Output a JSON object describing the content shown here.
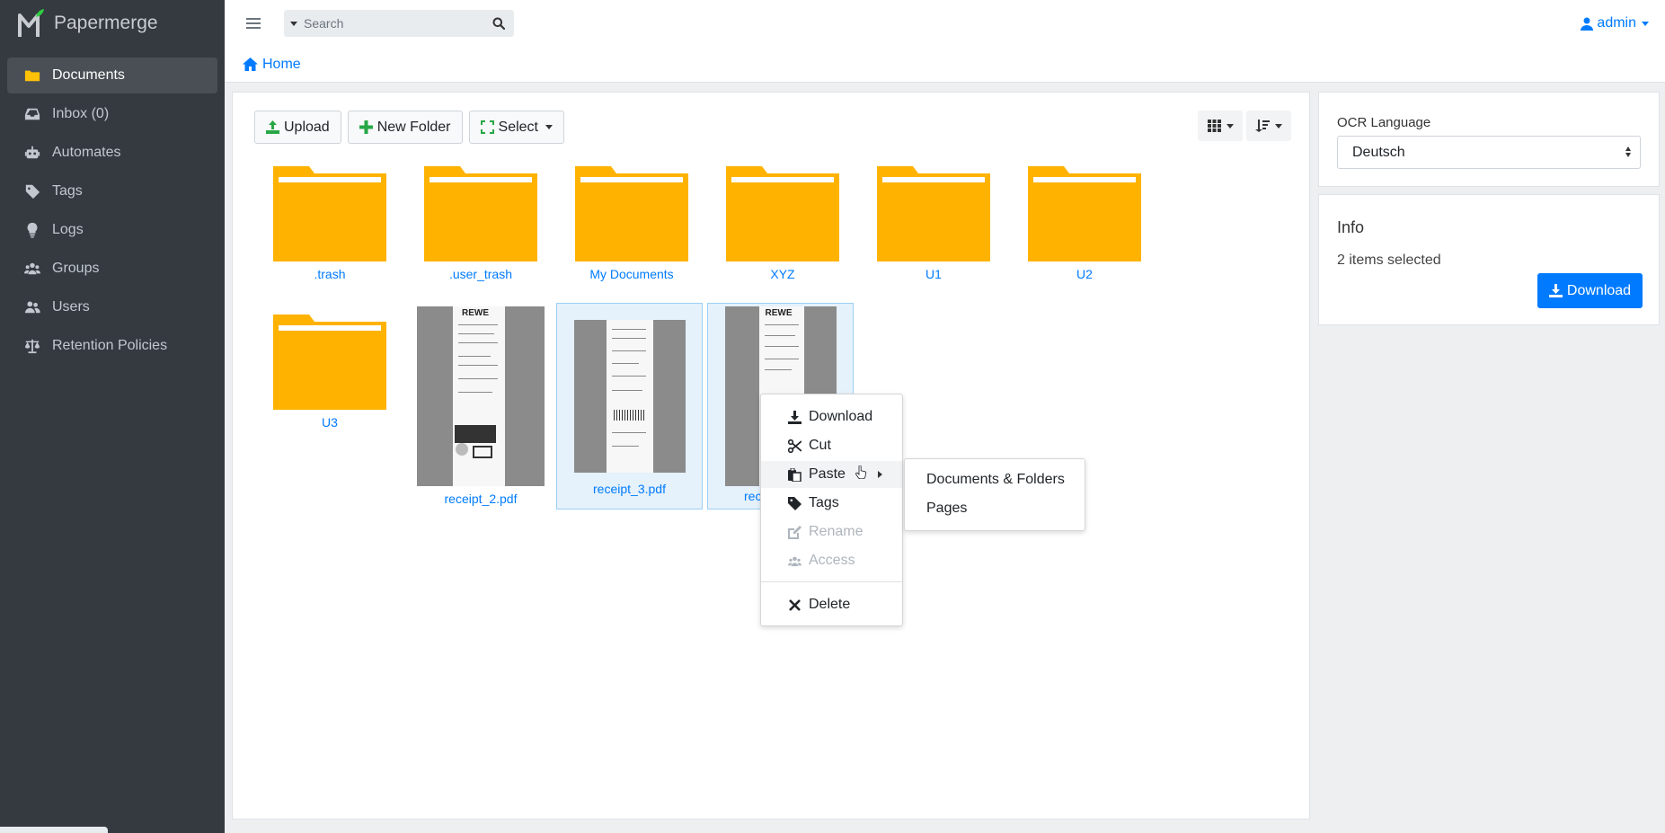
{
  "app": {
    "name": "Papermerge"
  },
  "sidebar": {
    "items": [
      {
        "label": "Documents",
        "icon": "folder-icon",
        "active": true
      },
      {
        "label": "Inbox (0)",
        "icon": "inbox-icon"
      },
      {
        "label": "Automates",
        "icon": "robot-icon"
      },
      {
        "label": "Tags",
        "icon": "tag-icon"
      },
      {
        "label": "Logs",
        "icon": "lightbulb-icon"
      },
      {
        "label": "Groups",
        "icon": "users-group-icon"
      },
      {
        "label": "Users",
        "icon": "users-icon"
      },
      {
        "label": "Retention Policies",
        "icon": "balance-scale-icon"
      }
    ]
  },
  "topbar": {
    "search_placeholder": "Search",
    "user": "admin"
  },
  "breadcrumb": {
    "home": "Home"
  },
  "toolbar": {
    "upload": "Upload",
    "new_folder": "New Folder",
    "select": "Select"
  },
  "items": [
    {
      "label": ".trash",
      "type": "folder"
    },
    {
      "label": ".user_trash",
      "type": "folder"
    },
    {
      "label": "My Documents",
      "type": "folder"
    },
    {
      "label": "XYZ",
      "type": "folder"
    },
    {
      "label": "U1",
      "type": "folder"
    },
    {
      "label": "U2",
      "type": "folder"
    },
    {
      "label": "U3",
      "type": "folder"
    },
    {
      "label": "receipt_2.pdf",
      "type": "document"
    },
    {
      "label": "receipt_3.pdf",
      "type": "document",
      "selected": true
    },
    {
      "label": "rec",
      "type": "document",
      "selected": true
    }
  ],
  "thumb_text": {
    "rewe": "REWE"
  },
  "ocr": {
    "label": "OCR Language",
    "value": "Deutsch"
  },
  "info": {
    "title": "Info",
    "text": "2 items selected",
    "download": "Download"
  },
  "context_menu": {
    "download": "Download",
    "cut": "Cut",
    "paste": "Paste",
    "tags": "Tags",
    "rename": "Rename",
    "access": "Access",
    "delete": "Delete"
  },
  "paste_submenu": {
    "docs_folders": "Documents & Folders",
    "pages": "Pages"
  },
  "colors": {
    "sidebar": "#343a40",
    "accent": "#007bff",
    "folder": "#ffb300"
  }
}
